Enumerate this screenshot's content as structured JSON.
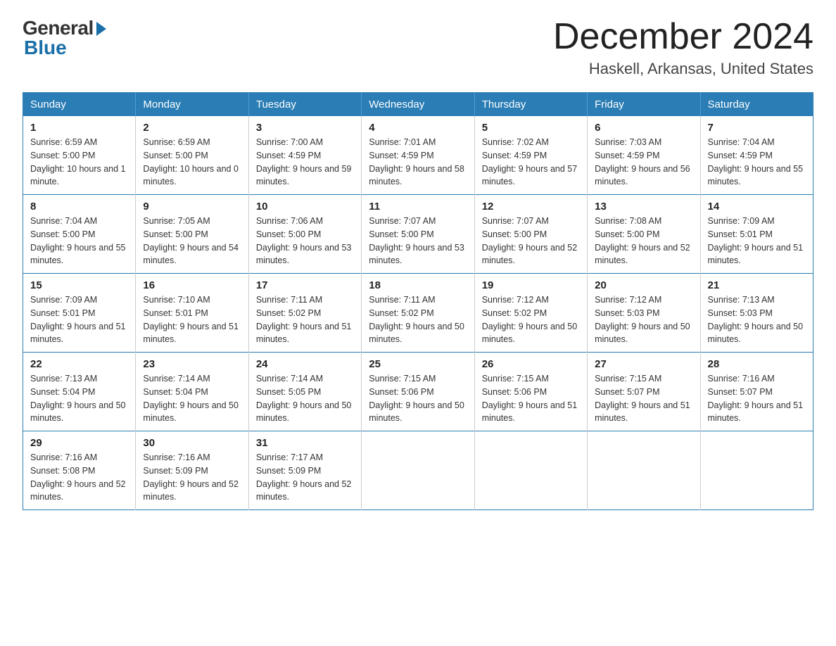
{
  "logo": {
    "general": "General",
    "blue": "Blue"
  },
  "title": "December 2024",
  "location": "Haskell, Arkansas, United States",
  "weekdays": [
    "Sunday",
    "Monday",
    "Tuesday",
    "Wednesday",
    "Thursday",
    "Friday",
    "Saturday"
  ],
  "weeks": [
    [
      {
        "day": "1",
        "sunrise": "6:59 AM",
        "sunset": "5:00 PM",
        "daylight": "10 hours and 1 minute."
      },
      {
        "day": "2",
        "sunrise": "6:59 AM",
        "sunset": "5:00 PM",
        "daylight": "10 hours and 0 minutes."
      },
      {
        "day": "3",
        "sunrise": "7:00 AM",
        "sunset": "4:59 PM",
        "daylight": "9 hours and 59 minutes."
      },
      {
        "day": "4",
        "sunrise": "7:01 AM",
        "sunset": "4:59 PM",
        "daylight": "9 hours and 58 minutes."
      },
      {
        "day": "5",
        "sunrise": "7:02 AM",
        "sunset": "4:59 PM",
        "daylight": "9 hours and 57 minutes."
      },
      {
        "day": "6",
        "sunrise": "7:03 AM",
        "sunset": "4:59 PM",
        "daylight": "9 hours and 56 minutes."
      },
      {
        "day": "7",
        "sunrise": "7:04 AM",
        "sunset": "4:59 PM",
        "daylight": "9 hours and 55 minutes."
      }
    ],
    [
      {
        "day": "8",
        "sunrise": "7:04 AM",
        "sunset": "5:00 PM",
        "daylight": "9 hours and 55 minutes."
      },
      {
        "day": "9",
        "sunrise": "7:05 AM",
        "sunset": "5:00 PM",
        "daylight": "9 hours and 54 minutes."
      },
      {
        "day": "10",
        "sunrise": "7:06 AM",
        "sunset": "5:00 PM",
        "daylight": "9 hours and 53 minutes."
      },
      {
        "day": "11",
        "sunrise": "7:07 AM",
        "sunset": "5:00 PM",
        "daylight": "9 hours and 53 minutes."
      },
      {
        "day": "12",
        "sunrise": "7:07 AM",
        "sunset": "5:00 PM",
        "daylight": "9 hours and 52 minutes."
      },
      {
        "day": "13",
        "sunrise": "7:08 AM",
        "sunset": "5:00 PM",
        "daylight": "9 hours and 52 minutes."
      },
      {
        "day": "14",
        "sunrise": "7:09 AM",
        "sunset": "5:01 PM",
        "daylight": "9 hours and 51 minutes."
      }
    ],
    [
      {
        "day": "15",
        "sunrise": "7:09 AM",
        "sunset": "5:01 PM",
        "daylight": "9 hours and 51 minutes."
      },
      {
        "day": "16",
        "sunrise": "7:10 AM",
        "sunset": "5:01 PM",
        "daylight": "9 hours and 51 minutes."
      },
      {
        "day": "17",
        "sunrise": "7:11 AM",
        "sunset": "5:02 PM",
        "daylight": "9 hours and 51 minutes."
      },
      {
        "day": "18",
        "sunrise": "7:11 AM",
        "sunset": "5:02 PM",
        "daylight": "9 hours and 50 minutes."
      },
      {
        "day": "19",
        "sunrise": "7:12 AM",
        "sunset": "5:02 PM",
        "daylight": "9 hours and 50 minutes."
      },
      {
        "day": "20",
        "sunrise": "7:12 AM",
        "sunset": "5:03 PM",
        "daylight": "9 hours and 50 minutes."
      },
      {
        "day": "21",
        "sunrise": "7:13 AM",
        "sunset": "5:03 PM",
        "daylight": "9 hours and 50 minutes."
      }
    ],
    [
      {
        "day": "22",
        "sunrise": "7:13 AM",
        "sunset": "5:04 PM",
        "daylight": "9 hours and 50 minutes."
      },
      {
        "day": "23",
        "sunrise": "7:14 AM",
        "sunset": "5:04 PM",
        "daylight": "9 hours and 50 minutes."
      },
      {
        "day": "24",
        "sunrise": "7:14 AM",
        "sunset": "5:05 PM",
        "daylight": "9 hours and 50 minutes."
      },
      {
        "day": "25",
        "sunrise": "7:15 AM",
        "sunset": "5:06 PM",
        "daylight": "9 hours and 50 minutes."
      },
      {
        "day": "26",
        "sunrise": "7:15 AM",
        "sunset": "5:06 PM",
        "daylight": "9 hours and 51 minutes."
      },
      {
        "day": "27",
        "sunrise": "7:15 AM",
        "sunset": "5:07 PM",
        "daylight": "9 hours and 51 minutes."
      },
      {
        "day": "28",
        "sunrise": "7:16 AM",
        "sunset": "5:07 PM",
        "daylight": "9 hours and 51 minutes."
      }
    ],
    [
      {
        "day": "29",
        "sunrise": "7:16 AM",
        "sunset": "5:08 PM",
        "daylight": "9 hours and 52 minutes."
      },
      {
        "day": "30",
        "sunrise": "7:16 AM",
        "sunset": "5:09 PM",
        "daylight": "9 hours and 52 minutes."
      },
      {
        "day": "31",
        "sunrise": "7:17 AM",
        "sunset": "5:09 PM",
        "daylight": "9 hours and 52 minutes."
      },
      null,
      null,
      null,
      null
    ]
  ]
}
